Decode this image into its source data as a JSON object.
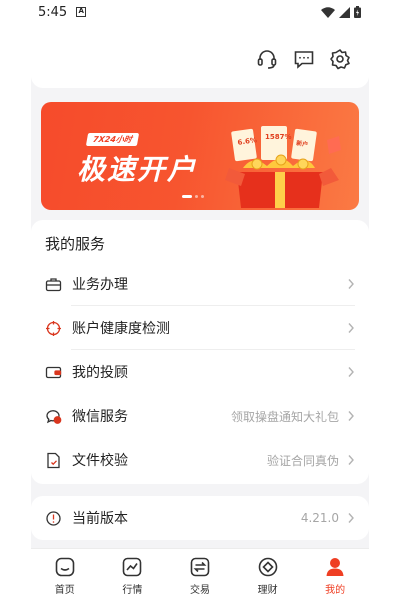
{
  "status_bar": {
    "time": "5:45",
    "notif_letter": "A"
  },
  "header": {
    "icons": [
      "headset-icon",
      "message-icon",
      "settings-icon"
    ]
  },
  "banner": {
    "tag": "7X24小时",
    "title": "极速开户",
    "slide_count": 3,
    "active_slide": 1,
    "colors": {
      "start": "#f64b2b",
      "end": "#fb7a44"
    }
  },
  "services": {
    "title": "我的服务",
    "items": [
      {
        "label": "业务办理",
        "hint": "",
        "icon": "briefcase-icon"
      },
      {
        "label": "账户健康度检测",
        "hint": "",
        "icon": "target-icon"
      },
      {
        "label": "我的投顾",
        "hint": "",
        "icon": "wallet-icon"
      },
      {
        "label": "微信服务",
        "hint": "领取操盘通知大礼包",
        "icon": "wechat-icon"
      },
      {
        "label": "文件校验",
        "hint": "验证合同真伪",
        "icon": "document-check-icon"
      }
    ]
  },
  "version": {
    "label": "当前版本",
    "value": "4.21.0",
    "icon": "info-icon"
  },
  "tabbar": {
    "tabs": [
      {
        "label": "首页",
        "icon": "home-icon",
        "active": false
      },
      {
        "label": "行情",
        "icon": "chart-icon",
        "active": false
      },
      {
        "label": "交易",
        "icon": "exchange-icon",
        "active": false
      },
      {
        "label": "理财",
        "icon": "finance-icon",
        "active": false
      },
      {
        "label": "我的",
        "icon": "profile-icon",
        "active": true
      }
    ]
  },
  "colors": {
    "accent": "#ef3e23",
    "background": "#f4f4f6",
    "hint": "#a6a6a6"
  }
}
